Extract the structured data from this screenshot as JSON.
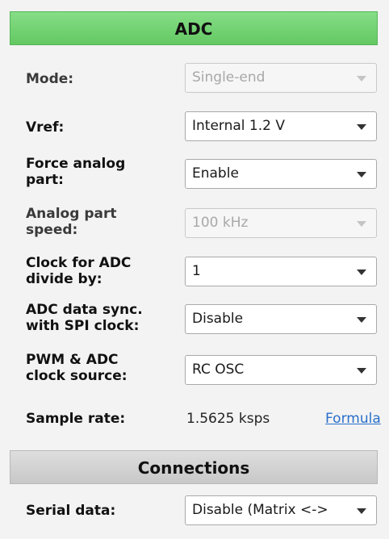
{
  "adc": {
    "header": "ADC",
    "mode": {
      "label": "Mode:",
      "value": "Single-end"
    },
    "vref": {
      "label": "Vref:",
      "value": "Internal 1.2 V"
    },
    "force_analog": {
      "label_line1": "Force analog",
      "label_line2": "part:",
      "value": "Enable"
    },
    "analog_speed": {
      "label_line1": "Analog part",
      "label_line2": "speed:",
      "value": "100 kHz"
    },
    "clock_divide": {
      "label_line1": "Clock for ADC",
      "label_line2": "divide by:",
      "value": "1"
    },
    "data_sync": {
      "label_line1": "ADC data sync.",
      "label_line2": "with SPI clock:",
      "value": "Disable"
    },
    "clock_source": {
      "label_line1": "PWM & ADC",
      "label_line2": "clock source:",
      "value": "RC OSC"
    },
    "sample_rate": {
      "label": "Sample rate:",
      "value": "1.5625 ksps",
      "link": "Formula"
    }
  },
  "connections": {
    "header": "Connections",
    "serial_data": {
      "label": "Serial data:",
      "value": "Disable (Matrix <->"
    }
  },
  "colors": {
    "adc_header": "#6ccf6c",
    "connections_header": "#d2d2d2",
    "link": "#2a6fc9"
  }
}
